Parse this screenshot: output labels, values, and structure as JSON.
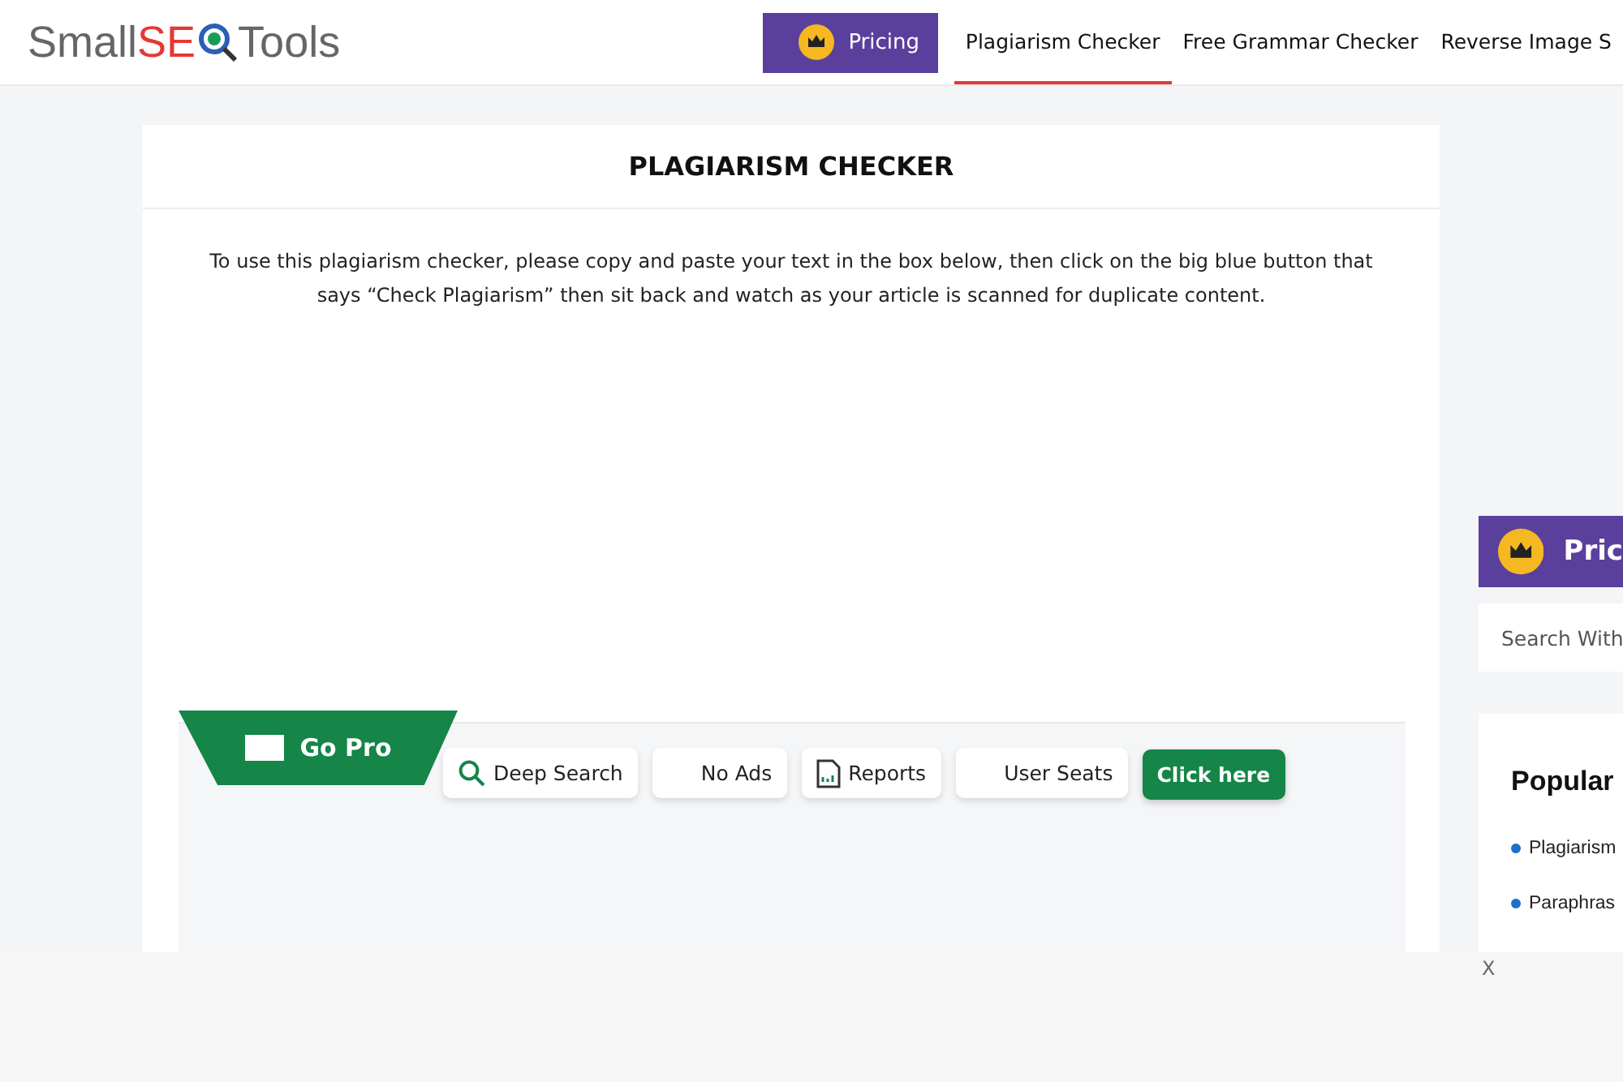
{
  "logo": {
    "prefix": "Small",
    "highlight": "SE",
    "suffix": "Tools"
  },
  "nav": {
    "pricing": "Pricing",
    "links": [
      {
        "label": "Plagiarism Checker",
        "selected": true
      },
      {
        "label": "Free Grammar Checker",
        "selected": false
      },
      {
        "label": "Reverse Image S",
        "selected": false
      }
    ]
  },
  "main": {
    "title": "PLAGIARISM CHECKER",
    "intro": "To use this plagiarism checker, please copy and paste your text in the box below, then click on the big blue button that says “Check Plagiarism” then sit back and watch as your article is scanned for duplicate content.",
    "promo": {
      "tab": "Go Pro",
      "features": [
        {
          "label": "Deep Search",
          "kind": "search"
        },
        {
          "label": "No Ads",
          "kind": "plain"
        },
        {
          "label": "Reports",
          "kind": "report"
        },
        {
          "label": "User Seats",
          "kind": "plain"
        }
      ],
      "cta": "Click here"
    }
  },
  "sidebar": {
    "pricing": "Pric",
    "search_placeholder": "Search With",
    "popular": {
      "title": "Popular",
      "items": [
        "Plagiarism",
        "Paraphras"
      ]
    }
  },
  "overlay": {
    "close": "X"
  }
}
